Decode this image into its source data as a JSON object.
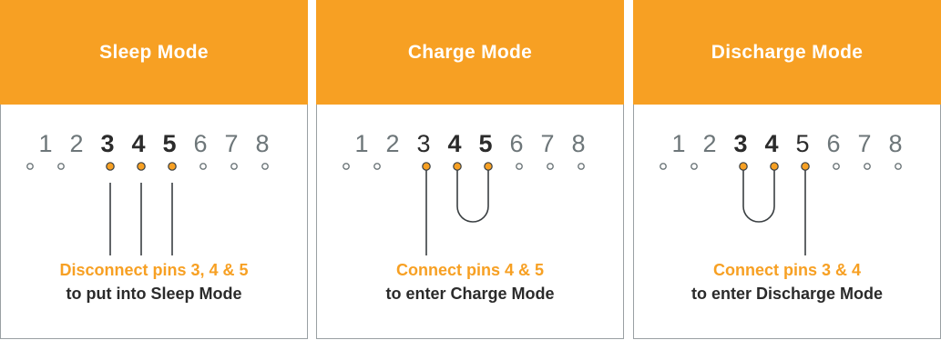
{
  "colors": {
    "accent": "#f7a023",
    "border": "#9aa0a3",
    "dot": "#6d7679",
    "wire": "#3a3f42"
  },
  "panels": [
    {
      "title": "Sleep Mode",
      "pins": [
        "1",
        "2",
        "3",
        "4",
        "5",
        "6",
        "7",
        "8"
      ],
      "bold_pins": [
        3,
        4,
        5
      ],
      "dark_pins": [],
      "active_pins": [
        3,
        4,
        5
      ],
      "wiring": "separate",
      "caption_line1": "Disconnect pins 3, 4 & 5",
      "caption_line2": "to put into Sleep Mode"
    },
    {
      "title": "Charge Mode",
      "pins": [
        "1",
        "2",
        "3",
        "4",
        "5",
        "6",
        "7",
        "8"
      ],
      "bold_pins": [
        4,
        5
      ],
      "dark_pins": [
        3
      ],
      "active_pins": [
        3,
        4,
        5
      ],
      "wiring": "loop-4-5",
      "caption_line1": "Connect pins 4 & 5",
      "caption_line2": "to enter Charge Mode"
    },
    {
      "title": "Discharge Mode",
      "pins": [
        "1",
        "2",
        "3",
        "4",
        "5",
        "6",
        "7",
        "8"
      ],
      "bold_pins": [
        3,
        4
      ],
      "dark_pins": [
        5
      ],
      "active_pins": [
        3,
        4,
        5
      ],
      "wiring": "loop-3-4",
      "caption_line1": "Connect pins 3 & 4",
      "caption_line2": "to enter Discharge Mode"
    }
  ]
}
